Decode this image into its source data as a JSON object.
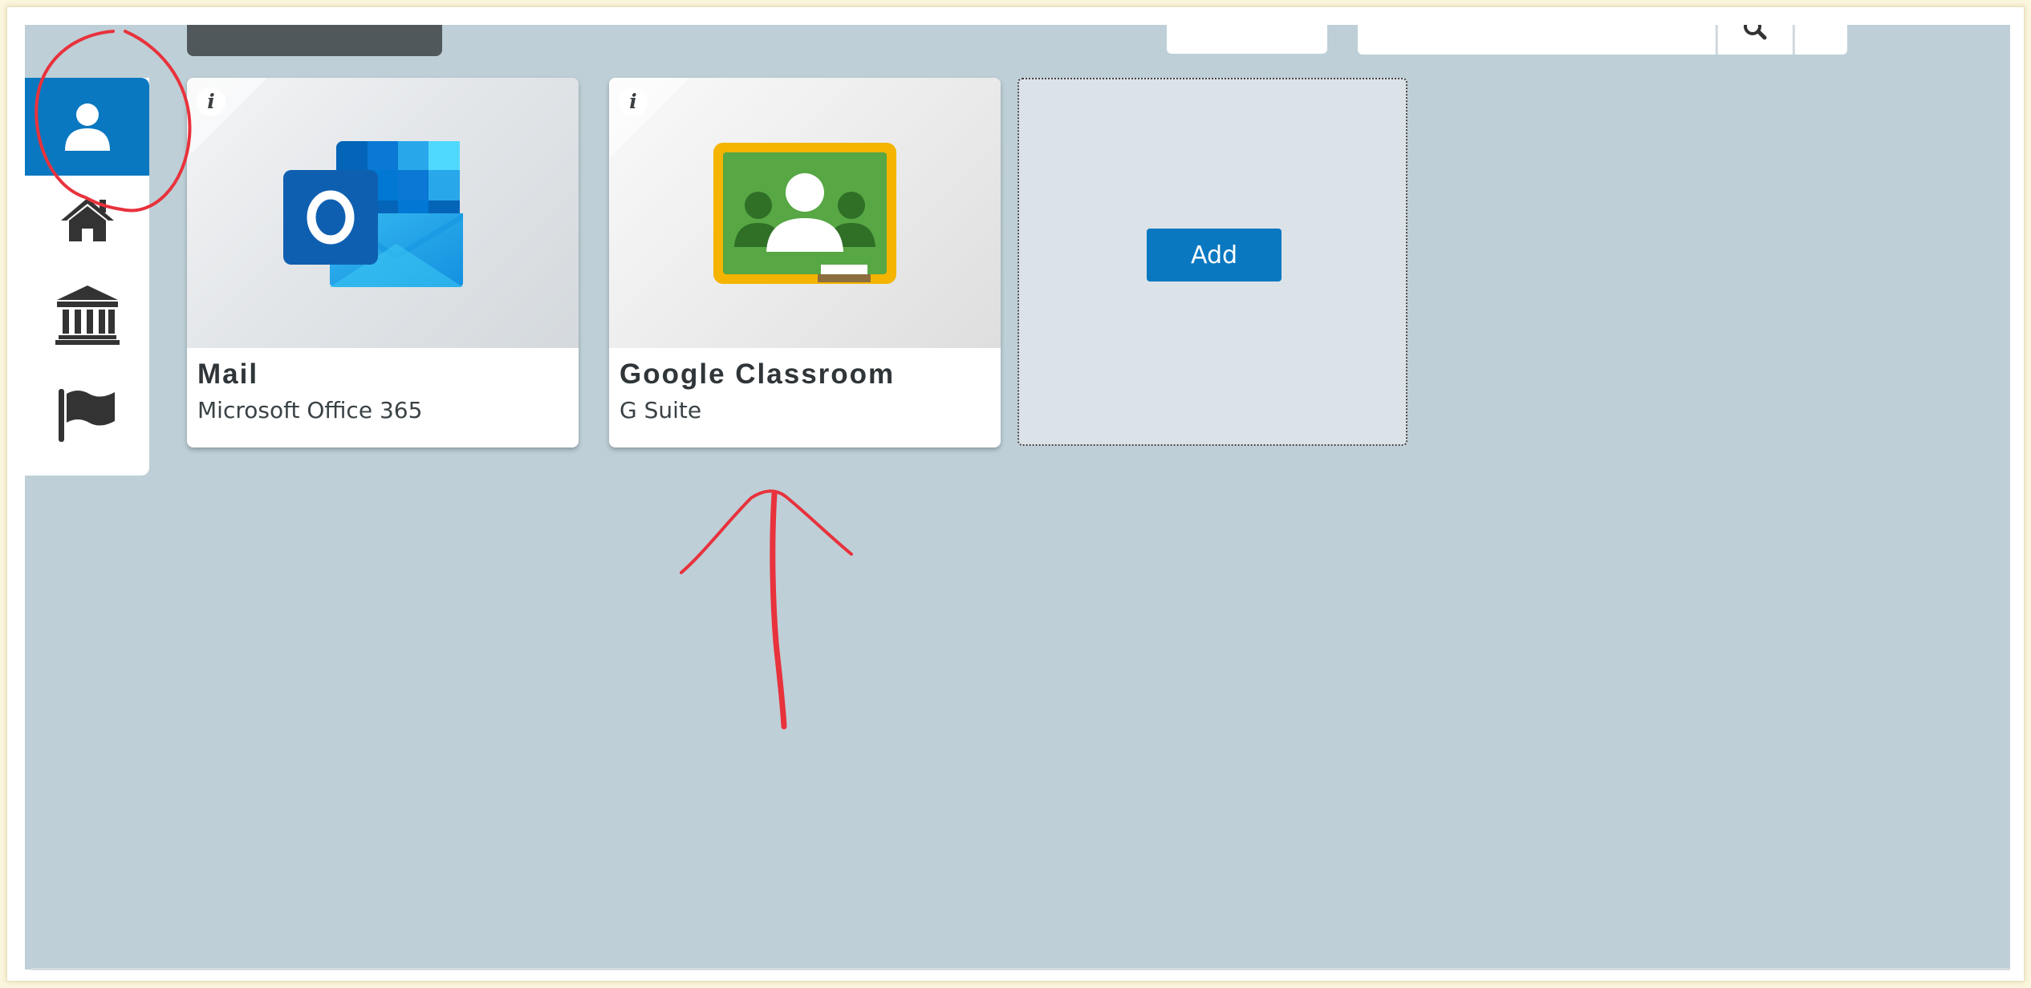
{
  "colors": {
    "accent": "#0a78c0",
    "screen_bg": "#becfd7",
    "annotation": "#e8323c"
  },
  "sidebar": {
    "items": [
      {
        "icon": "user-icon",
        "active": true
      },
      {
        "icon": "home-icon",
        "active": false
      },
      {
        "icon": "institution-icon",
        "active": false
      },
      {
        "icon": "flag-icon",
        "active": false
      }
    ]
  },
  "apps": [
    {
      "title": "Mail",
      "subtitle": "Microsoft Office 365",
      "icon": "outlook-icon",
      "info": "i"
    },
    {
      "title": "Google Classroom",
      "subtitle": "G Suite",
      "icon": "google-classroom-icon",
      "info": "i"
    }
  ],
  "add_card": {
    "button_label": "Add"
  },
  "topbar": {
    "search_icon": "search-icon"
  },
  "annotations": [
    {
      "shape": "circle",
      "target": "sidebar-user-item",
      "color": "#e8323c"
    },
    {
      "shape": "arrow",
      "target": "google-classroom-card",
      "color": "#e8323c"
    }
  ]
}
